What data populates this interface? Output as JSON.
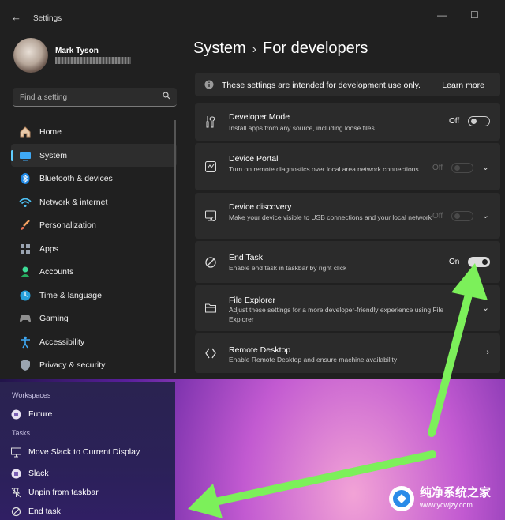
{
  "window": {
    "title": "Settings"
  },
  "profile": {
    "name": "Mark Tyson"
  },
  "search": {
    "placeholder": "Find a setting"
  },
  "nav": {
    "items": [
      {
        "label": "Home",
        "icon": "home-icon"
      },
      {
        "label": "System",
        "icon": "system-icon"
      },
      {
        "label": "Bluetooth & devices",
        "icon": "bluetooth-icon"
      },
      {
        "label": "Network & internet",
        "icon": "wifi-icon"
      },
      {
        "label": "Personalization",
        "icon": "brush-icon"
      },
      {
        "label": "Apps",
        "icon": "apps-icon"
      },
      {
        "label": "Accounts",
        "icon": "person-icon"
      },
      {
        "label": "Time & language",
        "icon": "globe-clock-icon"
      },
      {
        "label": "Gaming",
        "icon": "gamepad-icon"
      },
      {
        "label": "Accessibility",
        "icon": "accessibility-icon"
      },
      {
        "label": "Privacy & security",
        "icon": "shield-icon"
      }
    ]
  },
  "breadcrumb": {
    "parent": "System",
    "separator": "›",
    "current": "For developers"
  },
  "info": {
    "text": "These settings are intended for development use only.",
    "link": "Learn more"
  },
  "settings": [
    {
      "title": "Developer Mode",
      "desc": "Install apps from any source, including loose files",
      "state": "Off",
      "toggle": "off"
    },
    {
      "title": "Device Portal",
      "desc": "Turn on remote diagnostics over local area network connections",
      "state": "Off",
      "toggle": "disabled",
      "expand": true
    },
    {
      "title": "Device discovery",
      "desc": "Make your device visible to USB connections and your local network",
      "state": "Off",
      "toggle": "disabled",
      "expand": true
    },
    {
      "title": "End Task",
      "desc": "Enable end task in taskbar by right click",
      "state": "On",
      "toggle": "on"
    },
    {
      "title": "File Explorer",
      "desc": "Adjust these settings for a more developer-friendly experience using File Explorer",
      "expand": true
    },
    {
      "title": "Remote Desktop",
      "desc": "Enable Remote Desktop and ensure machine availability",
      "link": true
    }
  ],
  "jumplist": {
    "workspaces_header": "Workspaces",
    "workspace_item": "Future",
    "tasks_header": "Tasks",
    "tasks": [
      "Move Slack to Current Display"
    ],
    "app": "Slack",
    "unpin": "Unpin from taskbar",
    "end_task": "End task"
  },
  "watermark": {
    "text": "纯净系统之家",
    "url": "www.ycwjzy.com"
  },
  "colors": {
    "accent": "#60cdff",
    "arrow": "#7cf05a",
    "window_bg": "#202020",
    "card_bg": "#2b2b2b"
  }
}
